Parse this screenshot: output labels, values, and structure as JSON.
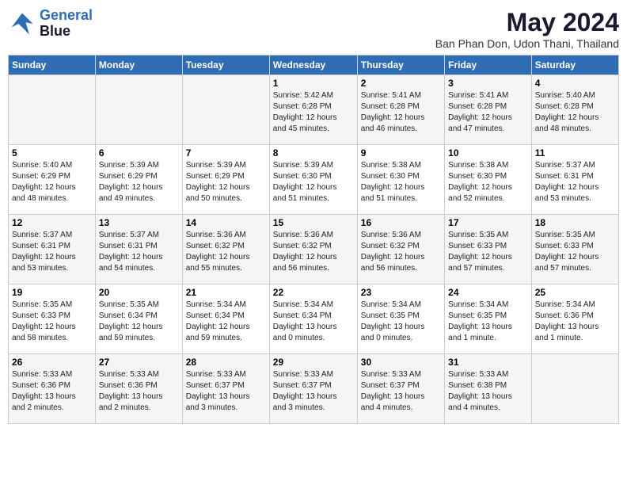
{
  "logo": {
    "line1": "General",
    "line2": "Blue"
  },
  "title": "May 2024",
  "location": "Ban Phan Don, Udon Thani, Thailand",
  "days_of_week": [
    "Sunday",
    "Monday",
    "Tuesday",
    "Wednesday",
    "Thursday",
    "Friday",
    "Saturday"
  ],
  "weeks": [
    [
      {
        "day": "",
        "info": ""
      },
      {
        "day": "",
        "info": ""
      },
      {
        "day": "",
        "info": ""
      },
      {
        "day": "1",
        "info": "Sunrise: 5:42 AM\nSunset: 6:28 PM\nDaylight: 12 hours\nand 45 minutes."
      },
      {
        "day": "2",
        "info": "Sunrise: 5:41 AM\nSunset: 6:28 PM\nDaylight: 12 hours\nand 46 minutes."
      },
      {
        "day": "3",
        "info": "Sunrise: 5:41 AM\nSunset: 6:28 PM\nDaylight: 12 hours\nand 47 minutes."
      },
      {
        "day": "4",
        "info": "Sunrise: 5:40 AM\nSunset: 6:28 PM\nDaylight: 12 hours\nand 48 minutes."
      }
    ],
    [
      {
        "day": "5",
        "info": "Sunrise: 5:40 AM\nSunset: 6:29 PM\nDaylight: 12 hours\nand 48 minutes."
      },
      {
        "day": "6",
        "info": "Sunrise: 5:39 AM\nSunset: 6:29 PM\nDaylight: 12 hours\nand 49 minutes."
      },
      {
        "day": "7",
        "info": "Sunrise: 5:39 AM\nSunset: 6:29 PM\nDaylight: 12 hours\nand 50 minutes."
      },
      {
        "day": "8",
        "info": "Sunrise: 5:39 AM\nSunset: 6:30 PM\nDaylight: 12 hours\nand 51 minutes."
      },
      {
        "day": "9",
        "info": "Sunrise: 5:38 AM\nSunset: 6:30 PM\nDaylight: 12 hours\nand 51 minutes."
      },
      {
        "day": "10",
        "info": "Sunrise: 5:38 AM\nSunset: 6:30 PM\nDaylight: 12 hours\nand 52 minutes."
      },
      {
        "day": "11",
        "info": "Sunrise: 5:37 AM\nSunset: 6:31 PM\nDaylight: 12 hours\nand 53 minutes."
      }
    ],
    [
      {
        "day": "12",
        "info": "Sunrise: 5:37 AM\nSunset: 6:31 PM\nDaylight: 12 hours\nand 53 minutes."
      },
      {
        "day": "13",
        "info": "Sunrise: 5:37 AM\nSunset: 6:31 PM\nDaylight: 12 hours\nand 54 minutes."
      },
      {
        "day": "14",
        "info": "Sunrise: 5:36 AM\nSunset: 6:32 PM\nDaylight: 12 hours\nand 55 minutes."
      },
      {
        "day": "15",
        "info": "Sunrise: 5:36 AM\nSunset: 6:32 PM\nDaylight: 12 hours\nand 56 minutes."
      },
      {
        "day": "16",
        "info": "Sunrise: 5:36 AM\nSunset: 6:32 PM\nDaylight: 12 hours\nand 56 minutes."
      },
      {
        "day": "17",
        "info": "Sunrise: 5:35 AM\nSunset: 6:33 PM\nDaylight: 12 hours\nand 57 minutes."
      },
      {
        "day": "18",
        "info": "Sunrise: 5:35 AM\nSunset: 6:33 PM\nDaylight: 12 hours\nand 57 minutes."
      }
    ],
    [
      {
        "day": "19",
        "info": "Sunrise: 5:35 AM\nSunset: 6:33 PM\nDaylight: 12 hours\nand 58 minutes."
      },
      {
        "day": "20",
        "info": "Sunrise: 5:35 AM\nSunset: 6:34 PM\nDaylight: 12 hours\nand 59 minutes."
      },
      {
        "day": "21",
        "info": "Sunrise: 5:34 AM\nSunset: 6:34 PM\nDaylight: 12 hours\nand 59 minutes."
      },
      {
        "day": "22",
        "info": "Sunrise: 5:34 AM\nSunset: 6:34 PM\nDaylight: 13 hours\nand 0 minutes."
      },
      {
        "day": "23",
        "info": "Sunrise: 5:34 AM\nSunset: 6:35 PM\nDaylight: 13 hours\nand 0 minutes."
      },
      {
        "day": "24",
        "info": "Sunrise: 5:34 AM\nSunset: 6:35 PM\nDaylight: 13 hours\nand 1 minute."
      },
      {
        "day": "25",
        "info": "Sunrise: 5:34 AM\nSunset: 6:36 PM\nDaylight: 13 hours\nand 1 minute."
      }
    ],
    [
      {
        "day": "26",
        "info": "Sunrise: 5:33 AM\nSunset: 6:36 PM\nDaylight: 13 hours\nand 2 minutes."
      },
      {
        "day": "27",
        "info": "Sunrise: 5:33 AM\nSunset: 6:36 PM\nDaylight: 13 hours\nand 2 minutes."
      },
      {
        "day": "28",
        "info": "Sunrise: 5:33 AM\nSunset: 6:37 PM\nDaylight: 13 hours\nand 3 minutes."
      },
      {
        "day": "29",
        "info": "Sunrise: 5:33 AM\nSunset: 6:37 PM\nDaylight: 13 hours\nand 3 minutes."
      },
      {
        "day": "30",
        "info": "Sunrise: 5:33 AM\nSunset: 6:37 PM\nDaylight: 13 hours\nand 4 minutes."
      },
      {
        "day": "31",
        "info": "Sunrise: 5:33 AM\nSunset: 6:38 PM\nDaylight: 13 hours\nand 4 minutes."
      },
      {
        "day": "",
        "info": ""
      }
    ]
  ]
}
